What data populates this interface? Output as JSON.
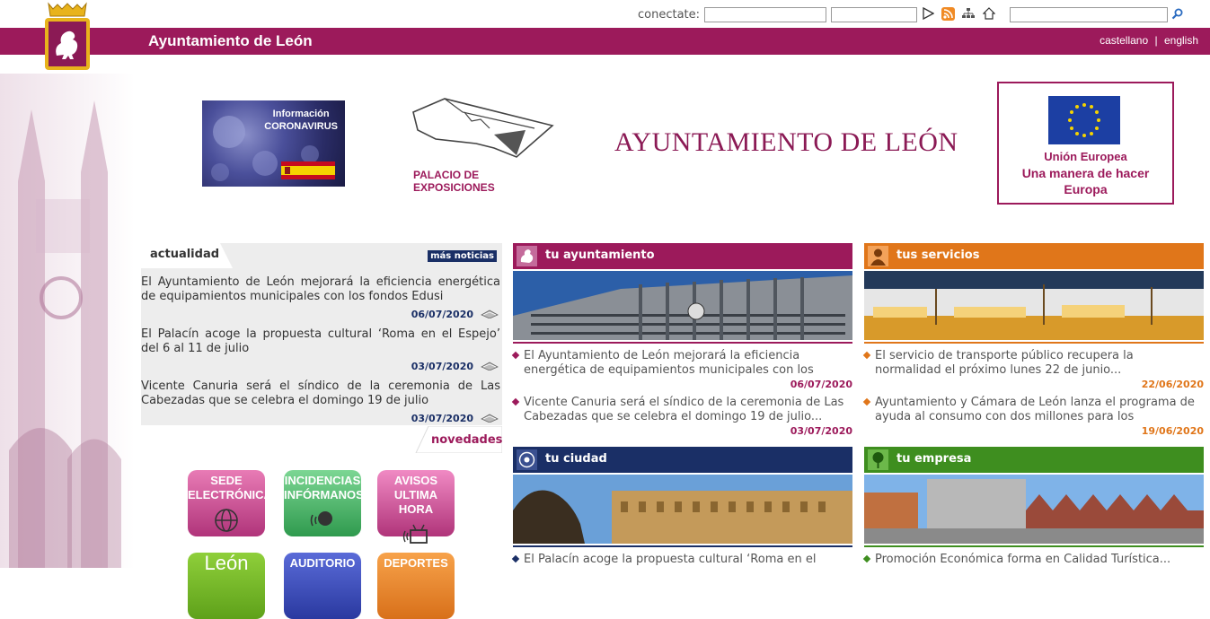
{
  "topbar": {
    "login_label": "conectate:",
    "user_value": "",
    "password_value": "",
    "search_value": ""
  },
  "brandbar": {
    "title": "Ayuntamiento de León",
    "lang_es": "castellano",
    "lang_sep": "|",
    "lang_en": "english"
  },
  "header": {
    "corona_line1": "Información",
    "corona_line2": "CORONAVIRUS",
    "palacio_label": "PALACIO DE EXPOSICIONES",
    "main_title": "AYUNTAMIENTO DE LEÓN",
    "eu_line1": "Unión Europea",
    "eu_line2": "Una manera de hacer",
    "eu_line3": "Europa"
  },
  "actualidad": {
    "tab_label": "actualidad",
    "more_label": "más noticias",
    "items": [
      {
        "text": "El Ayuntamiento de León mejorará la eficiencia energética de equipamientos municipales con los fondos Edusi",
        "date": "06/07/2020"
      },
      {
        "text": "El Palacín acoge la propuesta cultural ‘Roma en el Espejo’ del 6 al 11 de julio",
        "date": "03/07/2020"
      },
      {
        "text": "Vicente Canuria será el síndico de la ceremonia de Las Cabezadas que se celebra el domingo 19 de julio",
        "date": "03/07/2020"
      }
    ],
    "novedades_label": "novedades"
  },
  "quick_buttons": [
    {
      "line1": "SEDE",
      "line2": "ELECTRÓNICA"
    },
    {
      "line1": "INCIDENCIAS",
      "line2": "INFÓRMANOS"
    },
    {
      "line1": "AVISOS",
      "line2": "ULTIMA HORA"
    },
    {
      "line1": "León"
    },
    {
      "line1": "AUDITORIO"
    },
    {
      "line1": "DEPORTES"
    }
  ],
  "sections": {
    "ayuntamiento": {
      "title": "tu ayuntamiento",
      "items": [
        {
          "text": "El Ayuntamiento de León mejorará la eficiencia energética de equipamientos municipales con los",
          "date": "06/07/2020"
        },
        {
          "text": "Vicente Canuria será el síndico de la ceremonia de Las Cabezadas que se celebra el domingo 19 de julio...",
          "date": "03/07/2020"
        }
      ]
    },
    "servicios": {
      "title": "tus servicios",
      "items": [
        {
          "text": "El servicio de transporte público recupera la normalidad el próximo lunes 22 de junio...",
          "date": "22/06/2020"
        },
        {
          "text": "Ayuntamiento y Cámara de León lanza el programa de ayuda al consumo con dos millones para los",
          "date": "19/06/2020"
        }
      ]
    },
    "ciudad": {
      "title": "tu ciudad",
      "items": [
        {
          "text": "El Palacín acoge la propuesta cultural ‘Roma en el"
        }
      ]
    },
    "empresa": {
      "title": "tu empresa",
      "items": [
        {
          "text": "Promoción Económica forma en Calidad Turística..."
        }
      ]
    }
  },
  "colors": {
    "brand": "#9c1a5b",
    "ayuntamiento": "#9c1a5b",
    "servicios": "#e0761a",
    "ciudad": "#1a2f66",
    "empresa": "#3e8e1f"
  }
}
